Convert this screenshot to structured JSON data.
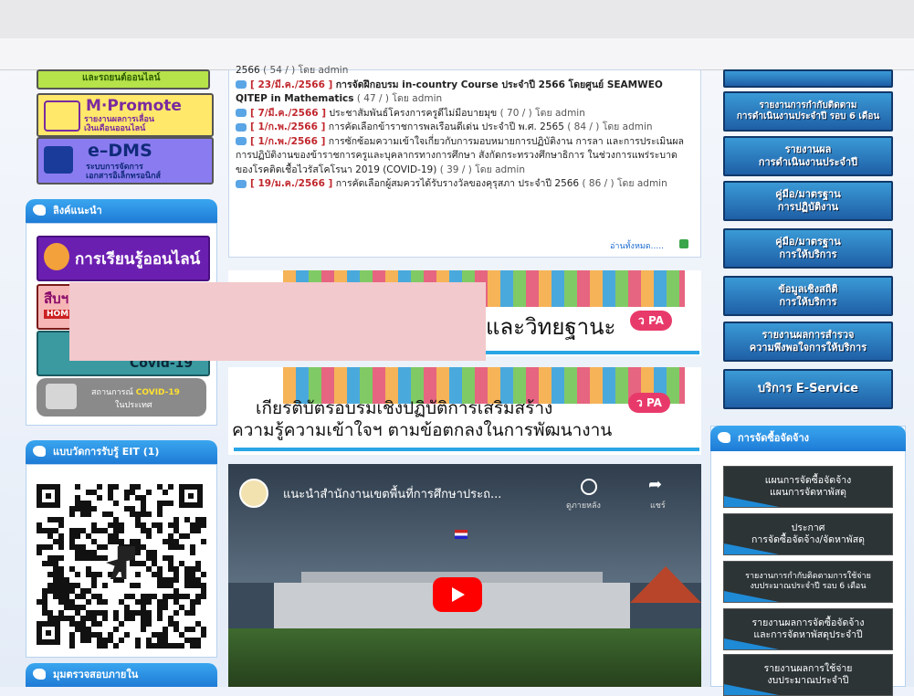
{
  "left": {
    "top_banner_fragment": "และรถยนต์ออนไลน์",
    "mpromote": {
      "title": "M·Promote",
      "sub1": "รายงานผลการเลื่อน",
      "sub2": "เงินเดือนออนไลน์"
    },
    "edms": {
      "title": "e–DMS",
      "sub1": "ระบบการจัดการ",
      "sub2": "เอกสารอิเล็กทรอนิกส์"
    },
    "links_heading": "ลิงค์แนะนำ",
    "online_learning": "การเรียนรู้ออนไลน์",
    "home_fragment": "สืบฯ",
    "home_sub": "HOME",
    "covid": "Covid-19",
    "covid_situation": {
      "pre": "สถานการณ์",
      "hl": "COVID-19",
      "post": "ในประเทศ"
    },
    "eit_heading": "แบบวัดการรับรู้ EIT (1)",
    "bottom_heading": "มุมตรวจสอบภายใน"
  },
  "news": {
    "items": [
      {
        "date": "",
        "text": "2566",
        "meta": "( 54 / ) โดย admin"
      },
      {
        "date": "[ 23/มี.ค./2566 ]",
        "text": "การจัดฝึกอบรม in-country Course ประจำปี 2566 โดยศูนย์ SEAMWEO QITEP in Mathematics",
        "meta": "( 47 / ) โดย admin"
      },
      {
        "date": "[ 7/มี.ค./2566 ]",
        "text": "ประชาสัมพันธ์โครงการครูดีไม่มีอบายมุข",
        "meta": "( 70 / ) โดย admin"
      },
      {
        "date": "[ 1/ก.พ./2566 ]",
        "text": "การคัดเลือกข้าราชการพลเรือนดีเด่น ประจำปี พ.ศ. 2565",
        "meta": "( 84 / ) โดย admin"
      },
      {
        "date": "[ 1/ก.พ./2566 ]",
        "text": "การซักซ้อมความเข้าใจเกี่ยวกับการมอบหมายการปฏิบัติงาน การลา และการประเมินผลการปฏิบัติงานของข้าราชการครูและบุคลากรทางการศึกษา สังกัดกระทรวงศึกษาธิการ ในช่วงการแพร่ระบาดของโรคติดเชื้อไวรัสโคโรนา 2019 (COVID-19)",
        "meta": "( 39 / ) โดย admin"
      },
      {
        "date": "[ 19/ม.ค./2566 ]",
        "text": "การคัดเลือกผู้สมควรได้รับรางวัลของคุรุสภา ประจำปี 2566",
        "meta": "( 86 / ) โดย admin"
      }
    ],
    "read_more": "อ่านทั้งหมด....."
  },
  "promo1": {
    "text": "และวิทยฐานะ",
    "badge": "ว PA"
  },
  "promo2": {
    "line1": "เกียรติบัตรอบรมเชิงปฏิบัติการเสริมสร้าง",
    "line2": "ความรู้ความเข้าใจฯ ตามข้อตกลงในการพัฒนางาน",
    "badge": "ว PA"
  },
  "video": {
    "title": "แนะนำสำนักงานเขตพื้นที่การศึกษาประถ...",
    "watch_later": "ดูภายหลัง",
    "share": "แชร์"
  },
  "right": {
    "buttons": [
      {
        "l1": "รายงานการกำกับติดตาม",
        "l2": "การดำเนินงานประจำปี รอบ 6 เดือน"
      },
      {
        "l1": "รายงานผล",
        "l2": "การดำเนินงานประจำปี"
      },
      {
        "l1": "คู่มือ/มาตรฐาน",
        "l2": "การปฏิบัติงาน"
      },
      {
        "l1": "คู่มือ/มาตรฐาน",
        "l2": "การให้บริการ"
      },
      {
        "l1": "ข้อมูลเชิงสถิติ",
        "l2": "การให้บริการ"
      },
      {
        "l1": "รายงานผลการสำรวจ",
        "l2": "ความพึงพอใจการให้บริการ"
      },
      {
        "l1": "บริการ E-Service",
        "l2": ""
      }
    ],
    "procurement_heading": "การจัดซื้อจัดจ้าง",
    "procurement": [
      {
        "l1": "แผนการจัดซื้อจัดจ้าง",
        "l2": "แผนการจัดหาพัสดุ"
      },
      {
        "l1": "ประกาศ",
        "l2": "การจัดซื้อจัดจ้าง/จัดหาพัสดุ"
      },
      {
        "l1": "รายงานการกำกับติดตามการใช้จ่าย",
        "l2": "งบประมาณประจำปี รอบ 6 เดือน"
      },
      {
        "l1": "รายงานผลการจัดซื้อจัดจ้าง",
        "l2": "และการจัดหาพัสดุประจำปี"
      },
      {
        "l1": "รายงานผลการใช้จ่าย",
        "l2": "งบประมาณประจำปี"
      }
    ]
  }
}
